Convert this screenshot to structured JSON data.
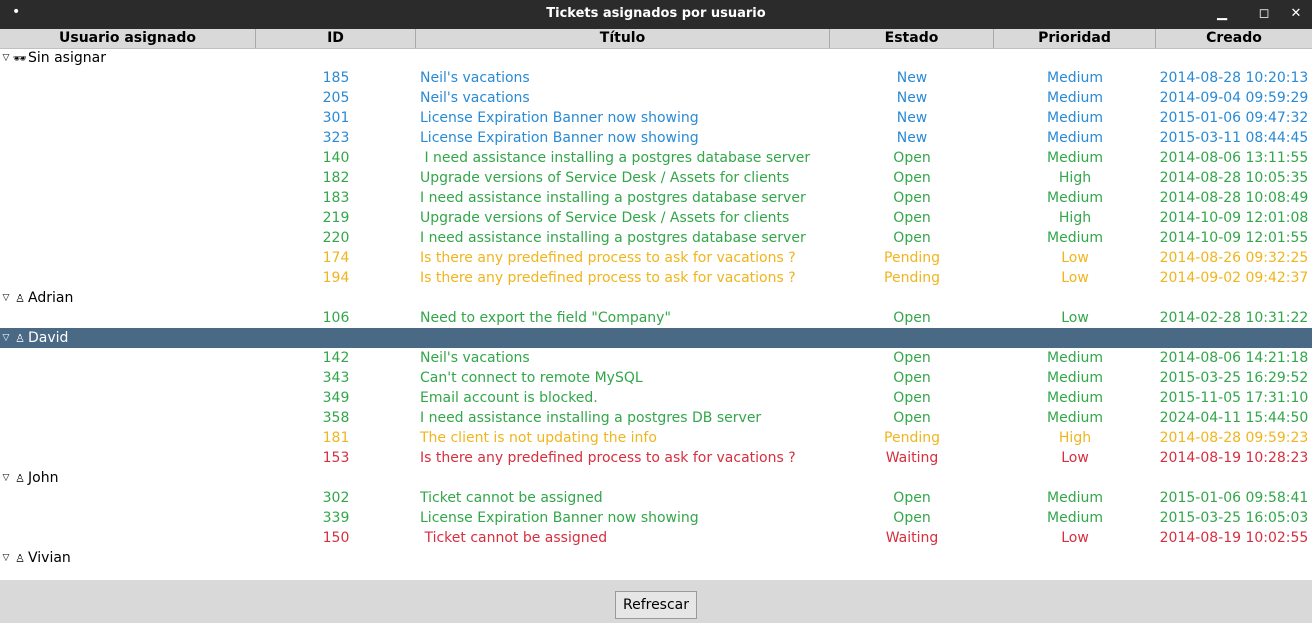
{
  "window": {
    "title": "Tickets asignados por usuario",
    "menu_glyph": "•",
    "minimize_glyph": "▁",
    "maximize_glyph": "◻",
    "close_glyph": "✕"
  },
  "columns": [
    "Usuario asignado",
    "ID",
    "Título",
    "Estado",
    "Prioridad",
    "Creado"
  ],
  "colors": {
    "new": "#2a8ad4",
    "open": "#33a64a",
    "pending": "#f0b51e",
    "waiting": "#d62f3f",
    "selected": "#4a6984"
  },
  "groups": [
    {
      "name": "Sin asignar",
      "icon": "glasses-icon",
      "icon_glyph": "🕶",
      "selected": false,
      "tickets": [
        {
          "id": "185",
          "title": "Neil's vacations",
          "state": "New",
          "priority": "Medium",
          "created": "2014-08-28 10:20:13",
          "status": "new"
        },
        {
          "id": "205",
          "title": "Neil's vacations",
          "state": "New",
          "priority": "Medium",
          "created": "2014-09-04 09:59:29",
          "status": "new"
        },
        {
          "id": "301",
          "title": "License Expiration Banner now showing",
          "state": "New",
          "priority": "Medium",
          "created": "2015-01-06 09:47:32",
          "status": "new"
        },
        {
          "id": "323",
          "title": "License Expiration Banner now showing",
          "state": "New",
          "priority": "Medium",
          "created": "2015-03-11 08:44:45",
          "status": "new"
        },
        {
          "id": "140",
          "title": " I need assistance installing a postgres database server",
          "state": "Open",
          "priority": "Medium",
          "created": "2014-08-06 13:11:55",
          "status": "open"
        },
        {
          "id": "182",
          "title": "Upgrade versions of Service Desk / Assets for clients",
          "state": "Open",
          "priority": "High",
          "created": "2014-08-28 10:05:35",
          "status": "open"
        },
        {
          "id": "183",
          "title": "I need assistance installing a postgres database server",
          "state": "Open",
          "priority": "Medium",
          "created": "2014-08-28 10:08:49",
          "status": "open"
        },
        {
          "id": "219",
          "title": "Upgrade versions of Service Desk / Assets for clients",
          "state": "Open",
          "priority": "High",
          "created": "2014-10-09 12:01:08",
          "status": "open"
        },
        {
          "id": "220",
          "title": "I need assistance installing a postgres database server",
          "state": "Open",
          "priority": "Medium",
          "created": "2014-10-09 12:01:55",
          "status": "open"
        },
        {
          "id": "174",
          "title": "Is there any predefined process to ask for vacations ?",
          "state": "Pending",
          "priority": "Low",
          "created": "2014-08-26 09:32:25",
          "status": "pending"
        },
        {
          "id": "194",
          "title": "Is there any predefined process to ask for vacations ?",
          "state": "Pending",
          "priority": "Low",
          "created": "2014-09-02 09:42:37",
          "status": "pending"
        }
      ]
    },
    {
      "name": "Adrian",
      "icon": "user-icon",
      "icon_glyph": "♙",
      "selected": false,
      "tickets": [
        {
          "id": "106",
          "title": "Need to export the field \"Company\"",
          "state": "Open",
          "priority": "Low",
          "created": "2014-02-28 10:31:22",
          "status": "open"
        }
      ]
    },
    {
      "name": "David",
      "icon": "user-icon",
      "icon_glyph": "♙",
      "selected": true,
      "tickets": [
        {
          "id": "142",
          "title": "Neil's vacations",
          "state": "Open",
          "priority": "Medium",
          "created": "2014-08-06 14:21:18",
          "status": "open"
        },
        {
          "id": "343",
          "title": "Can't connect to remote MySQL",
          "state": "Open",
          "priority": "Medium",
          "created": "2015-03-25 16:29:52",
          "status": "open"
        },
        {
          "id": "349",
          "title": "Email account is blocked.",
          "state": "Open",
          "priority": "Medium",
          "created": "2015-11-05 17:31:10",
          "status": "open"
        },
        {
          "id": "358",
          "title": "I need assistance installing a postgres DB server",
          "state": "Open",
          "priority": "Medium",
          "created": "2024-04-11 15:44:50",
          "status": "open"
        },
        {
          "id": "181",
          "title": "The client is not updating the info",
          "state": "Pending",
          "priority": "High",
          "created": "2014-08-28 09:59:23",
          "status": "pending"
        },
        {
          "id": "153",
          "title": "Is there any predefined process to ask for vacations ?",
          "state": "Waiting",
          "priority": "Low",
          "created": "2014-08-19 10:28:23",
          "status": "waiting"
        }
      ]
    },
    {
      "name": "John",
      "icon": "user-icon",
      "icon_glyph": "♙",
      "selected": false,
      "tickets": [
        {
          "id": "302",
          "title": "Ticket cannot be assigned",
          "state": "Open",
          "priority": "Medium",
          "created": "2015-01-06 09:58:41",
          "status": "open"
        },
        {
          "id": "339",
          "title": "License Expiration Banner now showing",
          "state": "Open",
          "priority": "Medium",
          "created": "2015-03-25 16:05:03",
          "status": "open"
        },
        {
          "id": "150",
          "title": " Ticket cannot be assigned",
          "state": "Waiting",
          "priority": "Low",
          "created": "2014-08-19 10:02:55",
          "status": "waiting"
        }
      ]
    },
    {
      "name": "Vivian",
      "icon": "user-icon",
      "icon_glyph": "♙",
      "selected": false,
      "tickets": []
    }
  ],
  "footer": {
    "refresh_label": "Refrescar"
  }
}
